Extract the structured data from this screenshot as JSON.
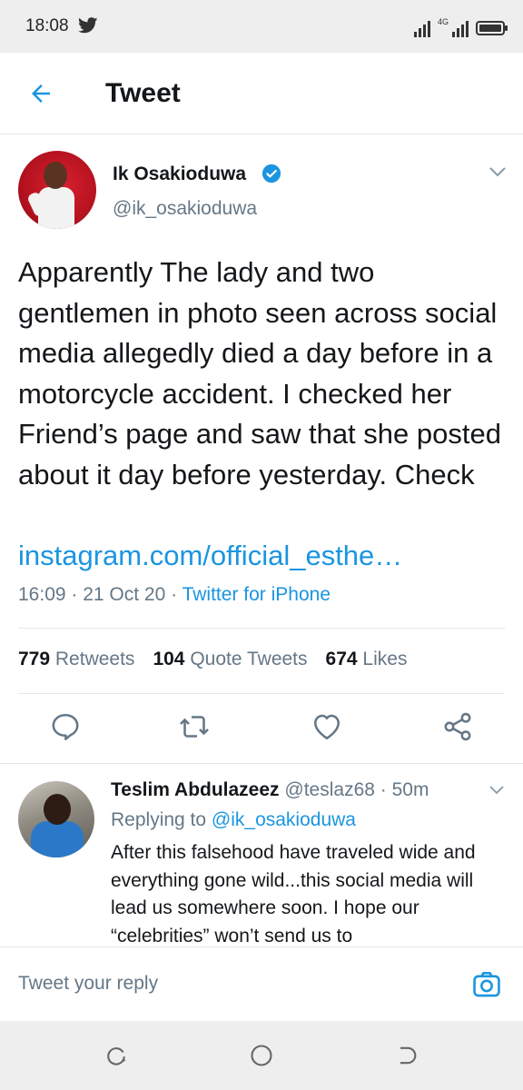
{
  "status_bar": {
    "time": "18:08",
    "network": "4G",
    "icons": [
      "twitter-bird-icon",
      "wifi-signal-icon",
      "cell-signal-icon",
      "battery-icon"
    ]
  },
  "header": {
    "title": "Tweet",
    "back_icon": "arrow-left-icon"
  },
  "tweet": {
    "author_name": "Ik Osakioduwa",
    "author_handle": "@ik_osakioduwa",
    "verified": true,
    "text": "Apparently The lady and two gentlemen in photo seen across social media allegedly died a day before in a motorcycle accident. I checked her Friend’s page and saw that she posted about it day before yesterday. Check",
    "link": "instagram.com/official_esthe…",
    "time": "16:09",
    "date": "21 Oct 20",
    "source": "Twitter for iPhone",
    "meta_separator": " · "
  },
  "stats": {
    "retweets_count": "779",
    "retweets_label": "Retweets",
    "quotes_count": "104",
    "quotes_label": "Quote Tweets",
    "likes_count": "674",
    "likes_label": "Likes"
  },
  "actions": [
    "reply-icon",
    "retweet-icon",
    "like-heart-icon",
    "share-icon"
  ],
  "reply": {
    "author_name": "Teslim Abdulazeez",
    "author_handle": "@teslaz68",
    "age": "50m",
    "replying_prefix": "Replying to",
    "replying_to": "@ik_osakioduwa",
    "text": "After this falsehood have traveled wide and everything gone wild...this social media will lead us somewhere soon. I hope our “celebrities” won’t send us to"
  },
  "composer": {
    "placeholder": "Tweet your reply"
  },
  "colors": {
    "accent": "#1b95e0",
    "text": "#14171a",
    "secondary": "#657786",
    "divider": "#e1e8ed",
    "system_bar": "#eeeeee"
  }
}
